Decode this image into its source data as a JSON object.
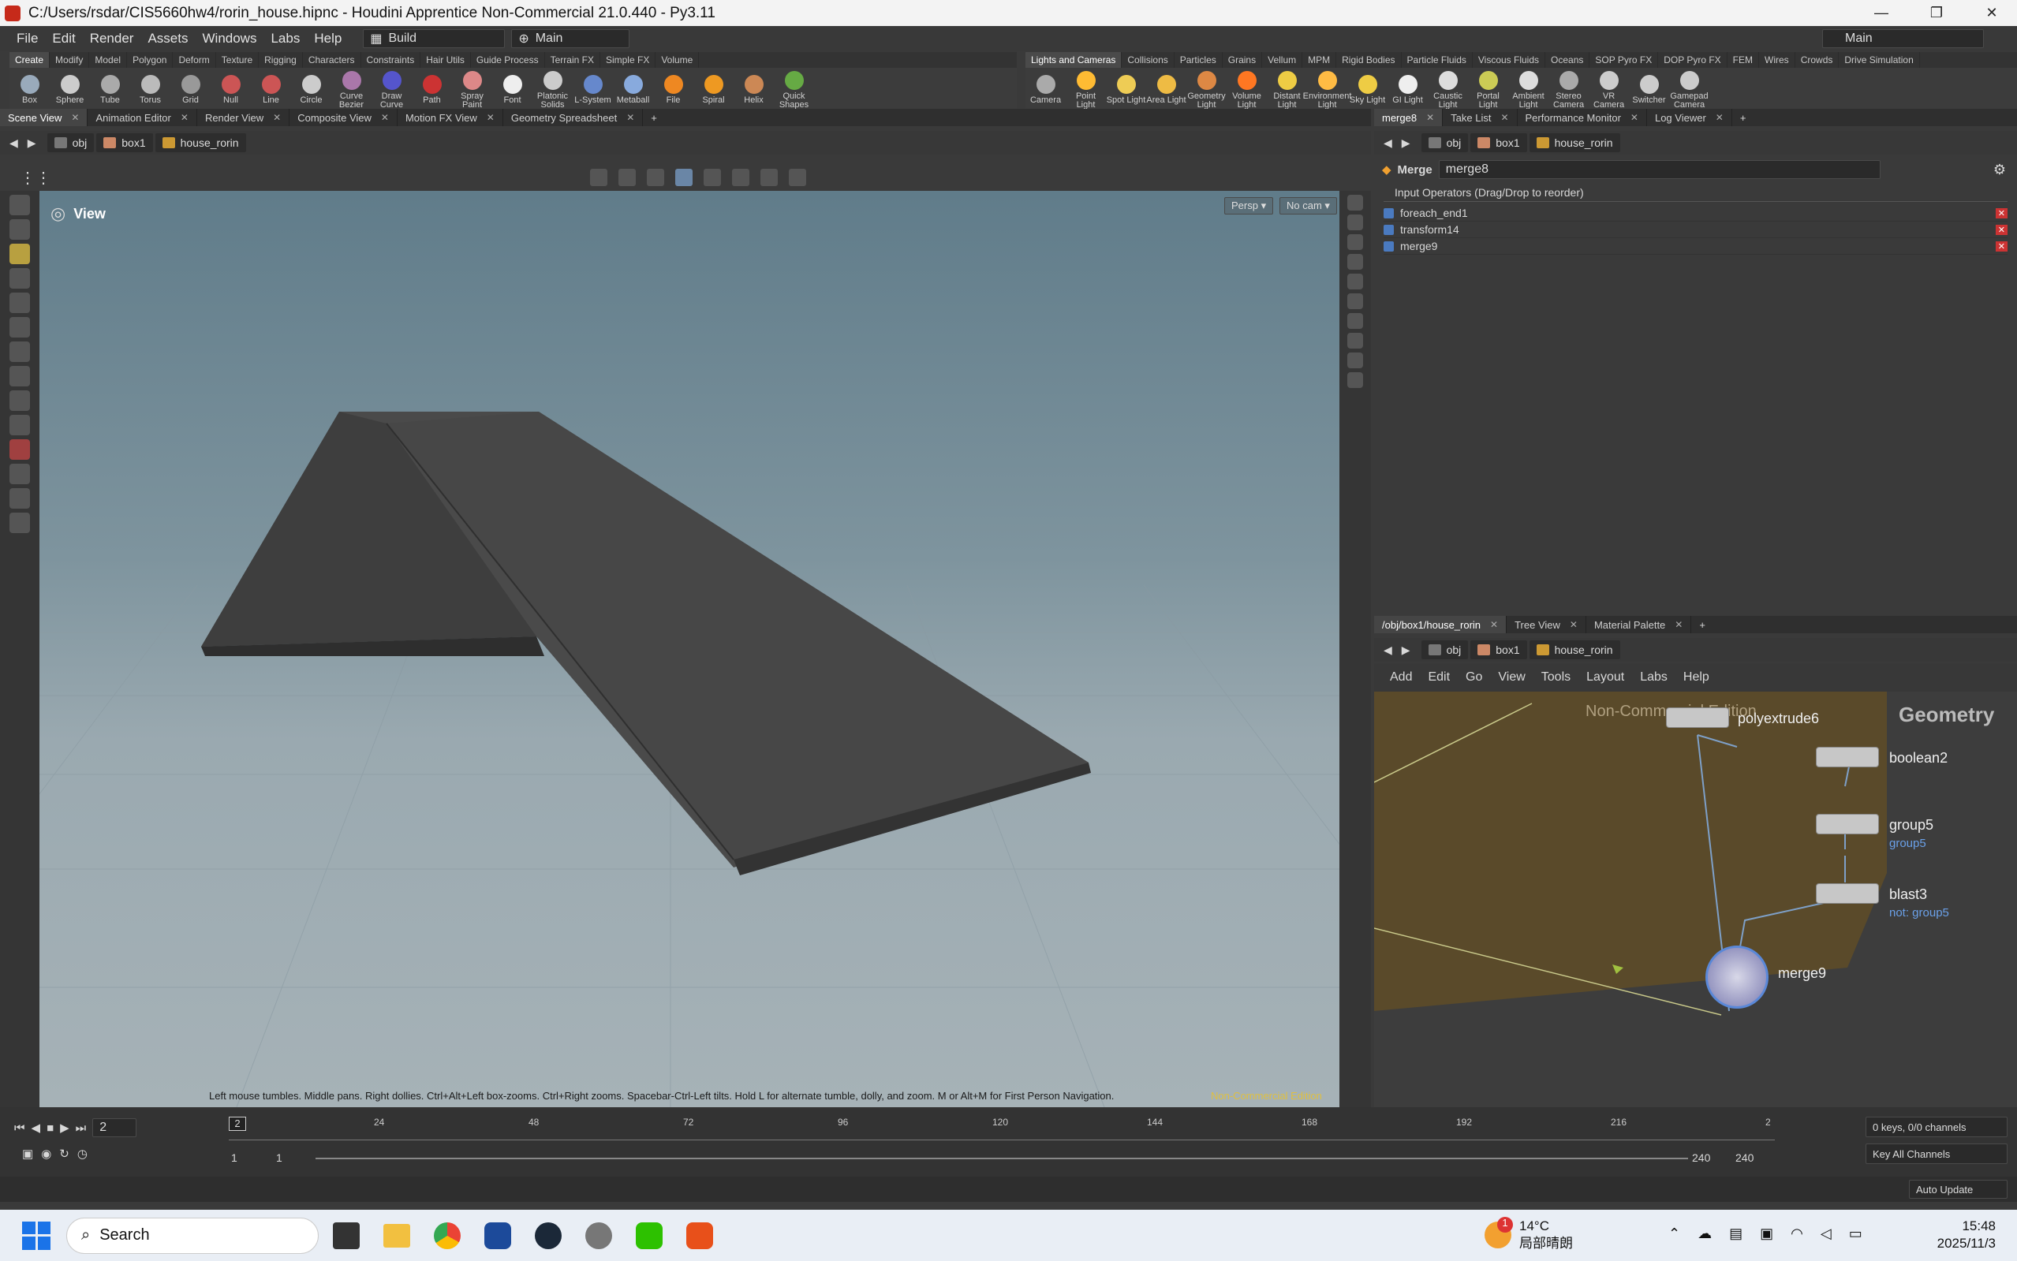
{
  "window": {
    "title": "C:/Users/rsdar/CIS5660hw4/rorin_house.hipnc - Houdini Apprentice Non-Commercial 21.0.440 - Py3.11",
    "minimize": "—",
    "maximize": "❐",
    "close": "✕"
  },
  "menu": {
    "items": [
      "File",
      "Edit",
      "Render",
      "Assets",
      "Windows",
      "Labs",
      "Help"
    ],
    "desktop_value": "Build",
    "network_value": "Main",
    "right_desktop": "Main"
  },
  "shelf_left": {
    "tabs": [
      "Create",
      "Modify",
      "Model",
      "Polygon",
      "Deform",
      "Texture",
      "Rigging",
      "Characters",
      "Constraints",
      "Hair Utils",
      "Guide Process",
      "Terrain FX",
      "Simple FX",
      "Volume"
    ],
    "tools": [
      "Box",
      "Sphere",
      "Tube",
      "Torus",
      "Grid",
      "Null",
      "Line",
      "Circle",
      "Curve Bezier",
      "Draw Curve",
      "Path",
      "Spray Paint",
      "Font",
      "Platonic Solids",
      "L-System",
      "Metaball",
      "File",
      "Spiral",
      "Helix",
      "Quick Shapes"
    ]
  },
  "shelf_right": {
    "tabs": [
      "Lights and Cameras",
      "Collisions",
      "Particles",
      "Grains",
      "Vellum",
      "MPM",
      "Rigid Bodies",
      "Particle Fluids",
      "Viscous Fluids",
      "Oceans",
      "SOP Pyro FX",
      "DOP Pyro FX",
      "FEM",
      "Wires",
      "Crowds",
      "Drive Simulation"
    ],
    "tools": [
      "Camera",
      "Point Light",
      "Spot Light",
      "Area Light",
      "Geometry Light",
      "Volume Light",
      "Distant Light",
      "Environment Light",
      "Sky Light",
      "GI Light",
      "Caustic Light",
      "Portal Light",
      "Ambient Light",
      "Stereo Camera",
      "VR Camera",
      "Switcher",
      "Gamepad Camera"
    ]
  },
  "left_pane": {
    "tabs": [
      "Scene View",
      "Animation Editor",
      "Render View",
      "Composite View",
      "Motion FX View",
      "Geometry Spreadsheet"
    ],
    "path": [
      "obj",
      "box1",
      "house_rorin"
    ],
    "view_label": "View",
    "persp": "Persp ▾",
    "cam": "No cam ▾",
    "hint": "Left mouse tumbles. Middle pans. Right dollies. Ctrl+Alt+Left box-zooms. Ctrl+Right zooms. Spacebar-Ctrl-Left tilts. Hold L for alternate tumble, dolly, and zoom. M or Alt+M for First Person Navigation.",
    "watermark": "Non-Commercial Edition"
  },
  "param_pane": {
    "tabs": [
      "merge8",
      "Take List",
      "Performance Monitor",
      "Log Viewer"
    ],
    "path": [
      "obj",
      "box1",
      "house_rorin"
    ],
    "node_type": "Merge",
    "node_name": "merge8",
    "section": "Input Operators (Drag/Drop to reorder)",
    "inputs": [
      "foreach_end1",
      "transform14",
      "merge9"
    ]
  },
  "network_pane": {
    "tabs": [
      "/obj/box1/house_rorin",
      "Tree View",
      "Material Palette"
    ],
    "path": [
      "obj",
      "box1",
      "house_rorin"
    ],
    "menu": [
      "Add",
      "Edit",
      "Go",
      "View",
      "Tools",
      "Layout",
      "Labs",
      "Help"
    ],
    "context": "Geometry",
    "watermark": "Non-Commercial Edition",
    "nodes": [
      {
        "name": "polyextrude6",
        "sub": ""
      },
      {
        "name": "boolean2",
        "sub": ""
      },
      {
        "name": "group5",
        "sub": "group5"
      },
      {
        "name": "blast3",
        "sub": "not: group5"
      },
      {
        "name": "merge9",
        "sub": ""
      }
    ]
  },
  "timeline": {
    "frame": "2",
    "marker": "2",
    "ticks": [
      "24",
      "48",
      "72",
      "96",
      "120",
      "144",
      "168",
      "192",
      "216",
      "2"
    ],
    "start": "1",
    "start2": "1",
    "end": "240",
    "end2": "240",
    "keys": "0 keys, 0/0 channels",
    "key_mode": "Key All Channels",
    "update": "Auto Update"
  },
  "taskbar": {
    "search": "Search",
    "temp": "14°C",
    "weather": "局部晴朗",
    "time": "15:48",
    "date": "2025/11/3",
    "badge": "1"
  },
  "colors": {
    "accent": "#f0a030",
    "node_bg": "#5a4a2a",
    "link_blue": "#6aa0e8"
  }
}
